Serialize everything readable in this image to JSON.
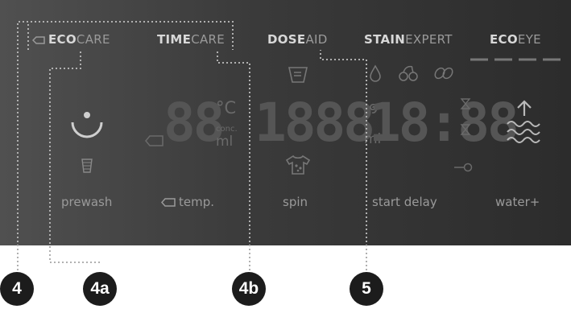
{
  "features": {
    "ecocare": {
      "bold": "ECO",
      "rest": "CARE"
    },
    "timecare": {
      "bold": "TIME",
      "rest": "CARE"
    },
    "doseaid": {
      "bold": "DOSE",
      "rest": "AID"
    },
    "stainexpert": {
      "bold": "STAIN",
      "rest": "EXPERT"
    },
    "ecoeye": {
      "bold": "ECO",
      "rest": "EYE"
    }
  },
  "labels": {
    "prewash": "prewash",
    "temp": "temp.",
    "spin": "spin",
    "start_delay": "start delay",
    "water_plus": "water+"
  },
  "display": {
    "temperature_digits": "88",
    "celsius_unit": "°C",
    "conc_label": "conc.",
    "ml_unit": "ml",
    "spin_digits": "1888",
    "spin_ml_unit": "ml",
    "time_digits": "18:88"
  },
  "callouts": [
    "4",
    "4a",
    "4b",
    "5"
  ],
  "colors": {
    "panel_dark": "#2c2c2c",
    "text_dim": "#9a9a9a",
    "text_bright": "#d8d8d8",
    "segment": "#555555",
    "callout_bg": "#1c1c1c"
  }
}
